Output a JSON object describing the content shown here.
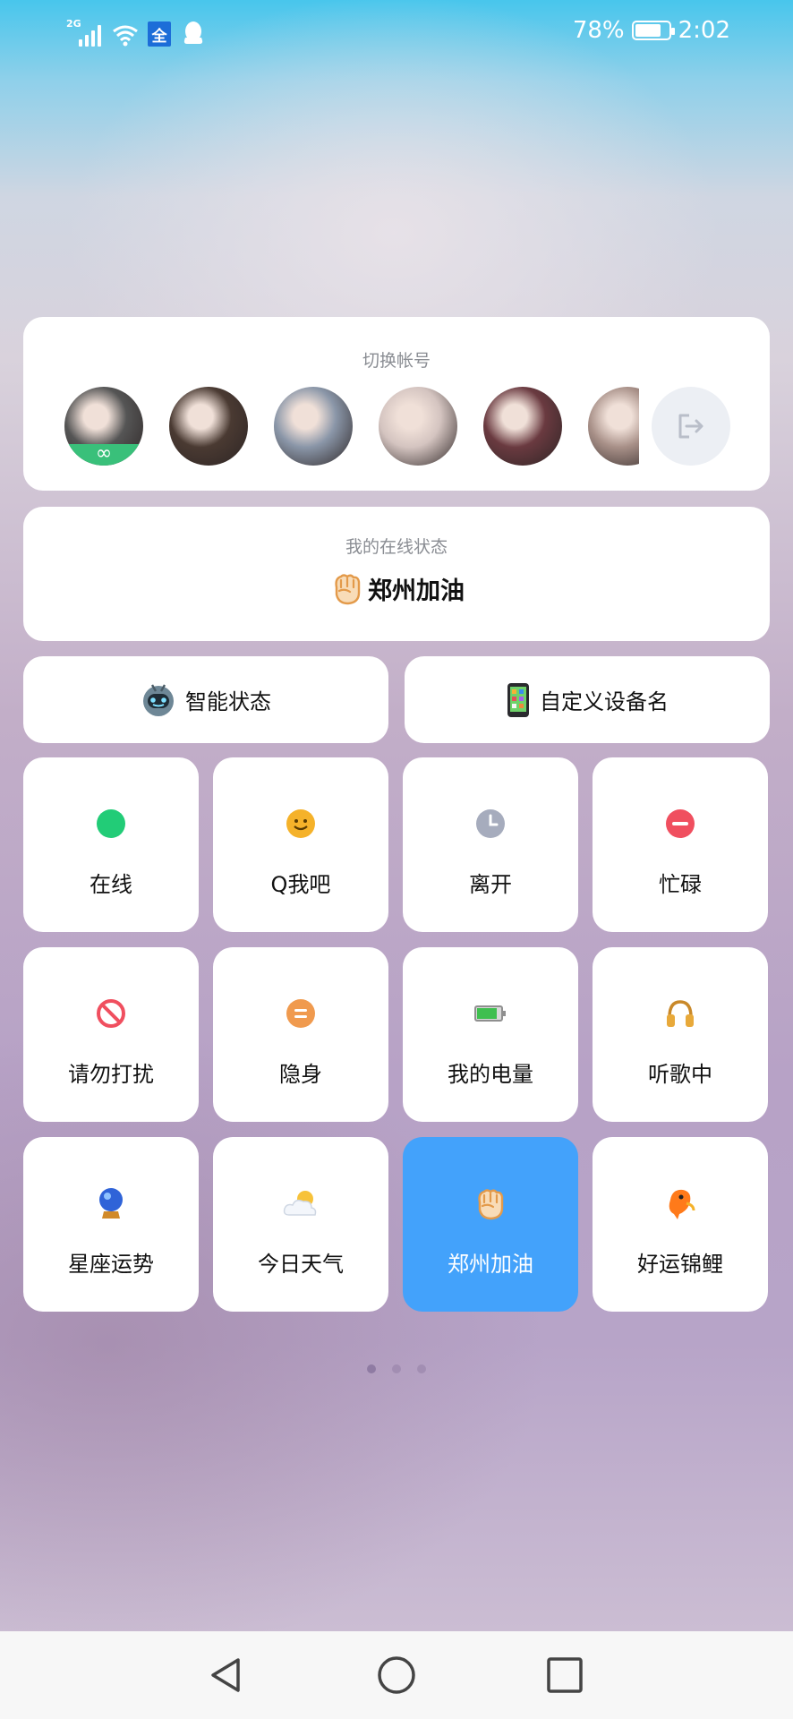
{
  "status_bar": {
    "network_type": "2G",
    "carrier_badge": "全",
    "battery_percent": "78%",
    "battery_level": 0.78,
    "time": "2:02",
    "icons": [
      "signal-icon",
      "wifi-icon",
      "carrier-badge-icon",
      "qq-penguin-icon",
      "battery-icon"
    ]
  },
  "accounts": {
    "title": "切换帐号",
    "avatars": [
      {
        "name": "account-1",
        "color": "#555555",
        "badge": "∞"
      },
      {
        "name": "account-2",
        "color": "#4a3a32"
      },
      {
        "name": "account-3",
        "color": "#8a96a8"
      },
      {
        "name": "account-4",
        "color": "#d4c4c0"
      },
      {
        "name": "account-5",
        "color": "#6a3a40"
      },
      {
        "name": "account-6",
        "color": "#a89088"
      }
    ],
    "logout_icon": "logout-icon"
  },
  "online_status": {
    "title": "我的在线状态",
    "value": "郑州加油",
    "icon": "fist-icon"
  },
  "quick_buttons": {
    "smart_status": {
      "label": "智能状态",
      "icon": "robot-icon"
    },
    "device_name": {
      "label": "自定义设备名",
      "icon": "phone-icon"
    }
  },
  "status_tiles": [
    {
      "label": "在线",
      "icon": "green-dot-icon"
    },
    {
      "label": "Q我吧",
      "icon": "smiley-icon"
    },
    {
      "label": "离开",
      "icon": "clock-icon"
    },
    {
      "label": "忙碌",
      "icon": "minus-circle-icon"
    },
    {
      "label": "请勿打扰",
      "icon": "no-entry-icon"
    },
    {
      "label": "隐身",
      "icon": "equals-circle-icon"
    },
    {
      "label": "我的电量",
      "icon": "battery-icon"
    },
    {
      "label": "听歌中",
      "icon": "headphones-icon"
    },
    {
      "label": "星座运势",
      "icon": "crystal-ball-icon"
    },
    {
      "label": "今日天气",
      "icon": "weather-icon"
    },
    {
      "label": "郑州加油",
      "icon": "fist-icon",
      "selected": true
    },
    {
      "label": "好运锦鲤",
      "icon": "koi-fish-icon"
    }
  ],
  "pager": {
    "total": 3,
    "current": 1
  },
  "colors": {
    "accent": "#43a2fb",
    "online_green": "#22cc77",
    "busy_red": "#f04f5f",
    "invisible_orange": "#f09a4e"
  }
}
